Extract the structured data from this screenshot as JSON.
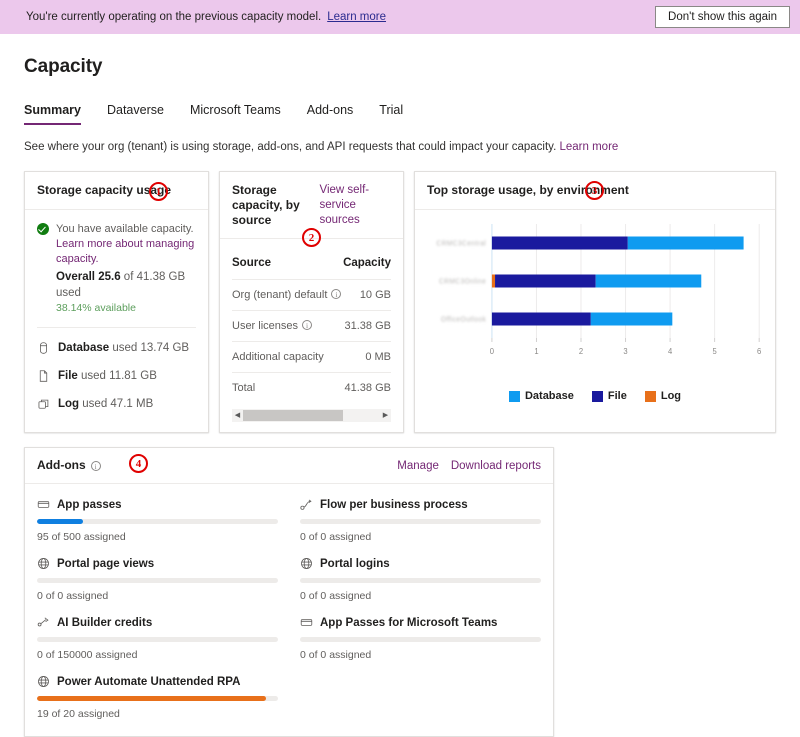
{
  "banner": {
    "message": "You're currently operating on the previous capacity model.",
    "link_label": "Learn more",
    "dismiss_label": "Don't show this again",
    "background": "#ecc8ec"
  },
  "page": {
    "title": "Capacity",
    "subtitle": "See where your org (tenant) is using storage, add-ons, and API requests that could impact your capacity.",
    "subtitle_link": "Learn more",
    "accent": "#742774"
  },
  "tabs": [
    {
      "label": "Summary",
      "active": true
    },
    {
      "label": "Dataverse",
      "active": false
    },
    {
      "label": "Microsoft Teams",
      "active": false
    },
    {
      "label": "Add-ons",
      "active": false
    },
    {
      "label": "Trial",
      "active": false
    }
  ],
  "annotations": [
    {
      "number": "1"
    },
    {
      "number": "2"
    },
    {
      "number": "3"
    },
    {
      "number": "4"
    }
  ],
  "storage_usage": {
    "title": "Storage capacity usage",
    "annotation": "1",
    "status_icon": "check-circle-icon",
    "status_text": "You have available capacity.",
    "status_link": "Learn more about managing capacity.",
    "overall_prefix": "Overall",
    "overall_value": "25.6",
    "overall_suffix": "of 41.38 GB used",
    "available_percent": "38.14% available",
    "available_color": "#5c9e5c",
    "lines": [
      {
        "icon": "database-icon",
        "label": "Database",
        "value": "used 13.74 GB"
      },
      {
        "icon": "file-icon",
        "label": "File",
        "value": "used 11.81 GB"
      },
      {
        "icon": "log-icon",
        "label": "Log",
        "value": "used 47.1 MB"
      }
    ]
  },
  "storage_by_source": {
    "title": "Storage capacity, by source",
    "head_link": "View self-service sources",
    "annotation": "2",
    "columns": [
      "Source",
      "Capacity"
    ],
    "rows": [
      {
        "source": "Org (tenant) default",
        "info": true,
        "capacity": "10 GB"
      },
      {
        "source": "User licenses",
        "info": true,
        "capacity": "31.38 GB"
      },
      {
        "source": "Additional capacity",
        "info": false,
        "capacity": "0 MB"
      },
      {
        "source": "Total",
        "info": false,
        "capacity": "41.38 GB"
      }
    ],
    "scrollbar": {
      "left_arrow": "◀",
      "right_arrow": "▶"
    }
  },
  "top_storage": {
    "title": "Top storage usage, by environment",
    "annotation": "3"
  },
  "chart_data": {
    "type": "bar",
    "orientation": "horizontal",
    "stacked": true,
    "title": "Top storage usage, by environment",
    "xlabel": "",
    "ylabel": "",
    "xlim": [
      0,
      6
    ],
    "xticks": [
      "0",
      "1",
      "2",
      "3",
      "4",
      "5",
      "6"
    ],
    "grid": true,
    "legend_position": "bottom",
    "categories": [
      "CRMC3Central",
      "CRMC3Online",
      "OfficeOutlook"
    ],
    "category_labels_redacted": true,
    "series": [
      {
        "name": "Database",
        "color": "#0f9bf0",
        "values": [
          2.6,
          2.37,
          1.83
        ]
      },
      {
        "name": "File",
        "color": "#1a1a9e",
        "values": [
          3.05,
          2.26,
          2.22
        ]
      },
      {
        "name": "Log",
        "color": "#e8701a",
        "values": [
          0.0,
          0.07,
          0.0
        ]
      }
    ],
    "stack_order": [
      "Log",
      "File",
      "Database"
    ],
    "legend": [
      "Database",
      "File",
      "Log"
    ]
  },
  "addons": {
    "title": "Add-ons",
    "info_icon": "info-icon",
    "annotation": "4",
    "actions": [
      "Manage",
      "Download reports"
    ],
    "items": [
      {
        "icon": "app-passes-icon",
        "name": "App passes",
        "assigned": 95,
        "total": 500,
        "meta": "95 of 500 assigned",
        "fill_percent": 19,
        "color": "#0f7fe0"
      },
      {
        "icon": "flow-icon",
        "name": "Flow per business process",
        "assigned": 0,
        "total": 0,
        "meta": "0 of 0 assigned",
        "fill_percent": 0,
        "color": "#0f7fe0"
      },
      {
        "icon": "globe-icon",
        "name": "Portal page views",
        "assigned": 0,
        "total": 0,
        "meta": "0 of 0 assigned",
        "fill_percent": 0,
        "color": "#0f7fe0"
      },
      {
        "icon": "globe-icon",
        "name": "Portal logins",
        "assigned": 0,
        "total": 0,
        "meta": "0 of 0 assigned",
        "fill_percent": 0,
        "color": "#0f7fe0"
      },
      {
        "icon": "ai-builder-icon",
        "name": "AI Builder credits",
        "assigned": 0,
        "total": 150000,
        "meta": "0 of 150000 assigned",
        "fill_percent": 0,
        "color": "#0f7fe0"
      },
      {
        "icon": "app-passes-icon",
        "name": "App Passes for Microsoft Teams",
        "assigned": 0,
        "total": 0,
        "meta": "0 of 0 assigned",
        "fill_percent": 0,
        "color": "#0f7fe0"
      },
      {
        "icon": "globe-icon",
        "name": "Power Automate Unattended RPA",
        "assigned": 19,
        "total": 20,
        "meta": "19 of 20 assigned",
        "fill_percent": 95,
        "color": "#e8701a"
      }
    ]
  }
}
